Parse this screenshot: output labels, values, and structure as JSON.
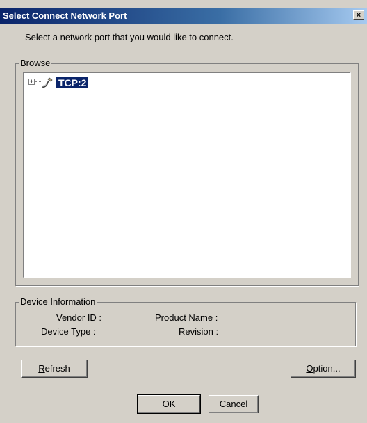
{
  "window": {
    "title": "Select Connect Network Port",
    "close_glyph": "×"
  },
  "instructions": "Select a network port that you would like to connect.",
  "browse": {
    "label": "Browse",
    "tree": [
      {
        "label": "TCP:2",
        "expander": "+",
        "icon": "network-port-icon",
        "selected": true
      }
    ]
  },
  "device_info": {
    "label": "Device Information",
    "vendor_id_label": "Vendor ID :",
    "device_type_label": "Device Type :",
    "product_name_label": "Product Name :",
    "revision_label": "Revision :"
  },
  "buttons": {
    "refresh_first": "R",
    "refresh_rest": "efresh",
    "option_first": "O",
    "option_rest": "ption...",
    "ok": "OK",
    "cancel": "Cancel"
  },
  "colors": {
    "title_bar": "#0a246a",
    "dialog_face": "#d4d0c8",
    "selection": "#0a246a"
  }
}
